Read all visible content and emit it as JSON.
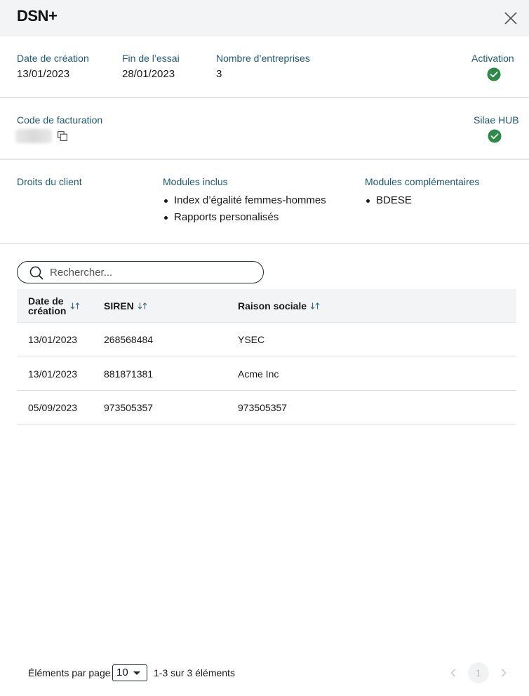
{
  "header": {
    "title": "DSN+"
  },
  "info": {
    "creation_date": {
      "label": "Date de création",
      "value": "13/01/2023"
    },
    "trial_end": {
      "label": "Fin de l’essai",
      "value": "28/01/2023"
    },
    "company_count": {
      "label": "Nombre d’entreprises",
      "value": "3"
    },
    "activation": {
      "label": "Activation",
      "status": "checked",
      "color": "#2e8b47"
    }
  },
  "billing": {
    "code_label": "Code de facturation",
    "hub": {
      "label": "Silae HUB",
      "status": "checked",
      "color": "#2e8b47"
    }
  },
  "rights": {
    "label": "Droits du client",
    "included_label": "Modules inclus",
    "included": [
      "Index d’égalité femmes-hommes",
      "Rapports personalisés"
    ],
    "extra_label": "Modules complémentaires",
    "extra": [
      "BDESE"
    ]
  },
  "search": {
    "placeholder": "Rechercher..."
  },
  "table": {
    "columns": [
      {
        "line1": "Date de",
        "line2": "création"
      },
      {
        "label": "SIREN"
      },
      {
        "label": "Raison sociale"
      }
    ],
    "rows": [
      [
        "13/01/2023",
        "268568484",
        "YSEC"
      ],
      [
        "13/01/2023",
        "881871381",
        "Acme Inc"
      ],
      [
        "05/09/2023",
        "973505357",
        "973505357"
      ]
    ]
  },
  "pagination": {
    "per_page_label": "Éléments par page",
    "per_page_value": "10",
    "range_text": "1-3 sur 3 éléments",
    "current_page": "1"
  },
  "colors": {
    "accent_label": "#1c5a78",
    "success": "#2e8b47",
    "header_bg": "#f2f4f5"
  }
}
